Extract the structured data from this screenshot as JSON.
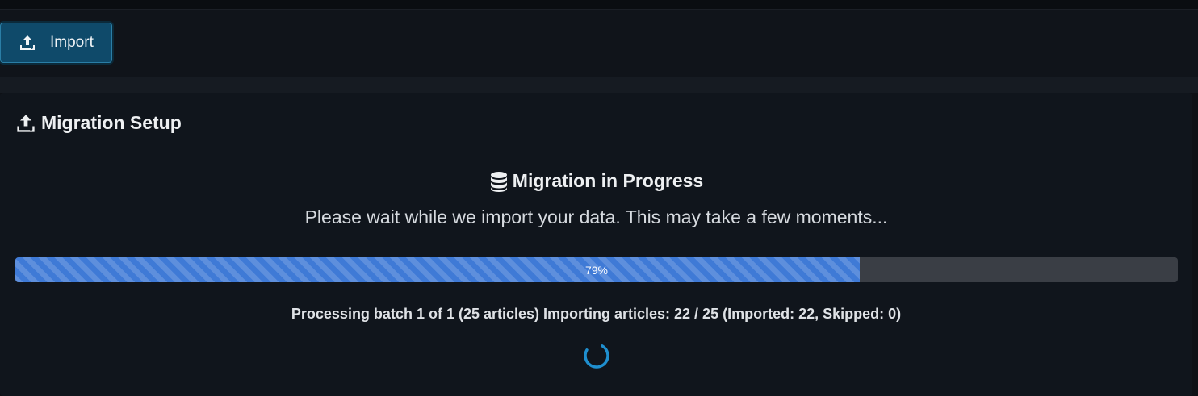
{
  "toolbar": {
    "import_label": "Import",
    "import_icon": "upload-icon"
  },
  "card": {
    "title": "Migration Setup",
    "title_icon": "upload-icon"
  },
  "progress": {
    "heading": "Migration in Progress",
    "heading_icon": "database-icon",
    "subtitle": "Please wait while we import your data. This may take a few moments...",
    "percent": 79,
    "percent_label": "79%",
    "status": "Processing batch 1 of 1 (25 articles) Importing articles: 22 / 25 (Imported: 22, Skipped: 0)",
    "spinner_icon": "loading-spinner-icon"
  },
  "colors": {
    "accent": "#3f7ad6",
    "button_bg": "#0f4a6a",
    "spinner": "#1f8fcf"
  }
}
